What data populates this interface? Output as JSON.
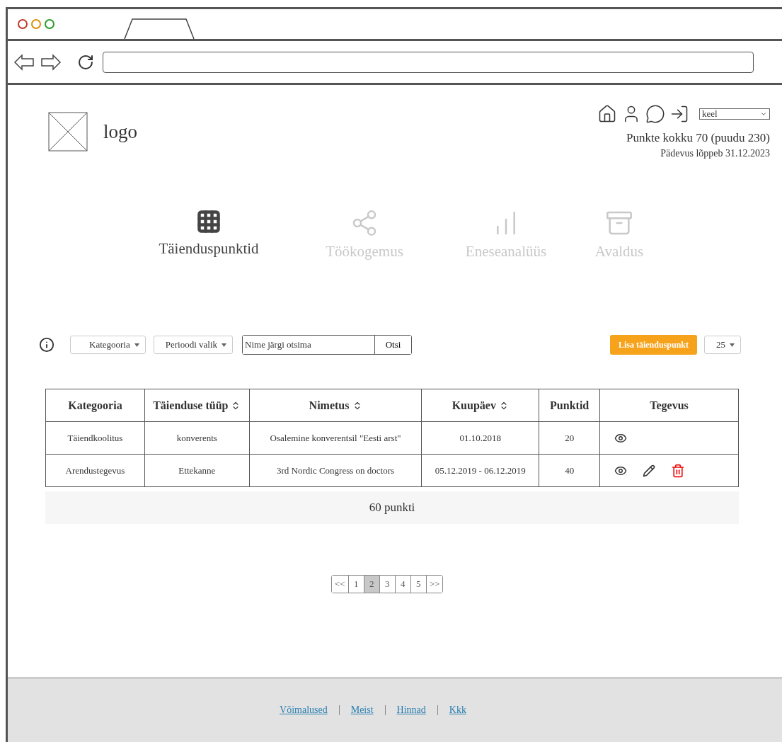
{
  "header": {
    "logo_text": "logo",
    "language_select": {
      "value": "keel"
    },
    "points_summary": "Punkte kokku 70 (puudu 230)",
    "competence_expiry": "Pädevus lõppeb 31.12.2023"
  },
  "sections": [
    {
      "label": "Täienduspunktid",
      "kind": "grid",
      "selected": true
    },
    {
      "label": "Töökogemus",
      "kind": "share",
      "selected": false
    },
    {
      "label": "Eneseanalüüs",
      "kind": "chart",
      "selected": false
    },
    {
      "label": "Avaldus",
      "kind": "archive",
      "selected": false
    }
  ],
  "toolbar": {
    "category_filter": "Kategooria",
    "period_filter": "Perioodi valik",
    "search": {
      "placeholder": "Nime järgi otsima"
    },
    "search_button": "Otsi",
    "add_button": "Lisa täienduspunkt",
    "page_size": "25"
  },
  "table": {
    "columns": [
      {
        "label": "Kategooria",
        "sortable": false
      },
      {
        "label": "Täienduse tüüp",
        "sortable": true
      },
      {
        "label": "Nimetus",
        "sortable": true
      },
      {
        "label": "Kuupäev",
        "sortable": true
      },
      {
        "label": "Punktid",
        "sortable": false
      },
      {
        "label": "Tegevus",
        "sortable": false
      }
    ],
    "rows": [
      {
        "cells": [
          "Täiendkoolitus",
          "konverents",
          "Osalemine konverentsil \"Eesti arst\"",
          "01.10.2018",
          "20"
        ],
        "actions": [
          {
            "kind": "view"
          }
        ]
      },
      {
        "cells": [
          "Arendustegevus",
          "Ettekanne",
          "3rd Nordic Congress on doctors",
          "05.12.2019 - 06.12.2019",
          "40"
        ],
        "actions": [
          {
            "kind": "view"
          },
          {
            "kind": "edit"
          },
          {
            "kind": "delete"
          }
        ]
      }
    ],
    "total": "60 punkti"
  },
  "pagination": [
    {
      "label": "<<",
      "selected": false
    },
    {
      "label": "1",
      "selected": false
    },
    {
      "label": "2",
      "selected": true
    },
    {
      "label": "3",
      "selected": false
    },
    {
      "label": "4",
      "selected": false
    },
    {
      "label": "5",
      "selected": false
    },
    {
      "label": ">>",
      "selected": false
    }
  ],
  "footer": {
    "links": [
      "Võimalused",
      "Meist",
      "Hinnad",
      "Kkk"
    ]
  }
}
